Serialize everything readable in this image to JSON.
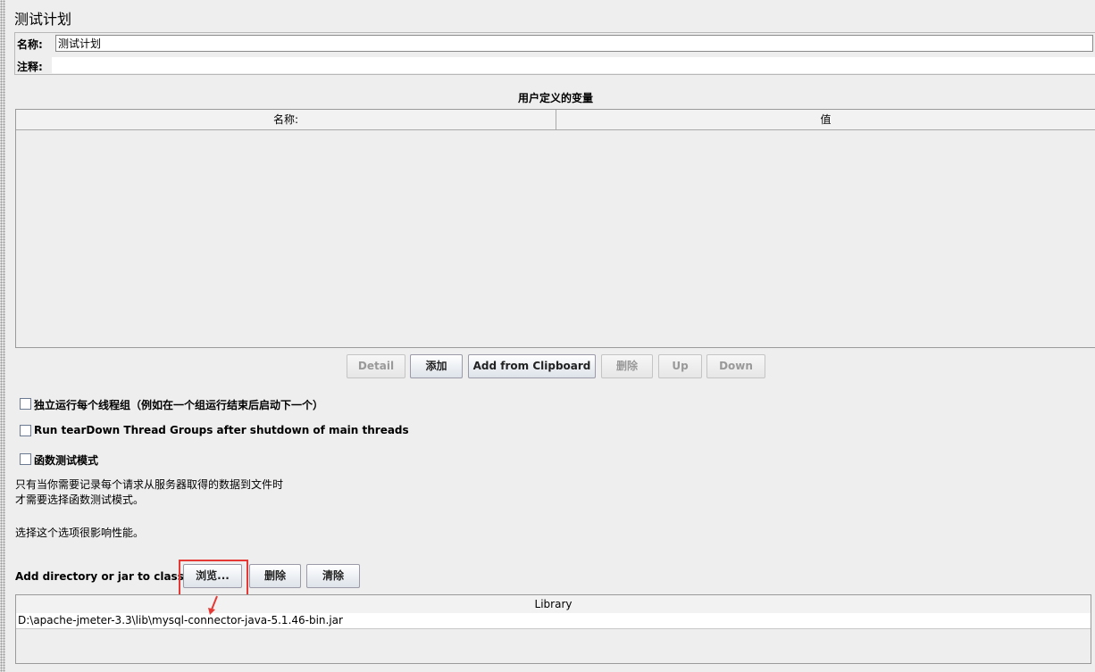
{
  "plan": {
    "title": "测试计划",
    "name_label": "名称:",
    "name_value": "测试计划",
    "comment_label": "注释:",
    "comment_value": ""
  },
  "variables": {
    "title": "用户定义的变量",
    "columns": [
      "名称:",
      "值"
    ],
    "rows": []
  },
  "var_buttons": {
    "detail": "Detail",
    "add": "添加",
    "add_clipboard": "Add from Clipboard",
    "delete": "删除",
    "up": "Up",
    "down": "Down"
  },
  "options": {
    "serialize": "独立运行每个线程组（例如在一个组运行结束后启动下一个）",
    "teardown": "Run tearDown Thread Groups after shutdown of main threads",
    "functional": "函数测试模式"
  },
  "functional_note": {
    "line1": "只有当你需要记录每个请求从服务器取得的数据到文件时",
    "line2": "才需要选择函数测试模式。",
    "line3": "选择这个选项很影响性能。"
  },
  "classpath": {
    "label": "Add directory or jar to classpath",
    "browse": "浏览...",
    "delete": "删除",
    "clear": "清除",
    "library_header": "Library",
    "entries": [
      "D:\\apache-jmeter-3.3\\lib\\mysql-connector-java-5.1.46-bin.jar"
    ]
  },
  "colors": {
    "highlight": "#e53935",
    "background": "#eeeeee"
  }
}
